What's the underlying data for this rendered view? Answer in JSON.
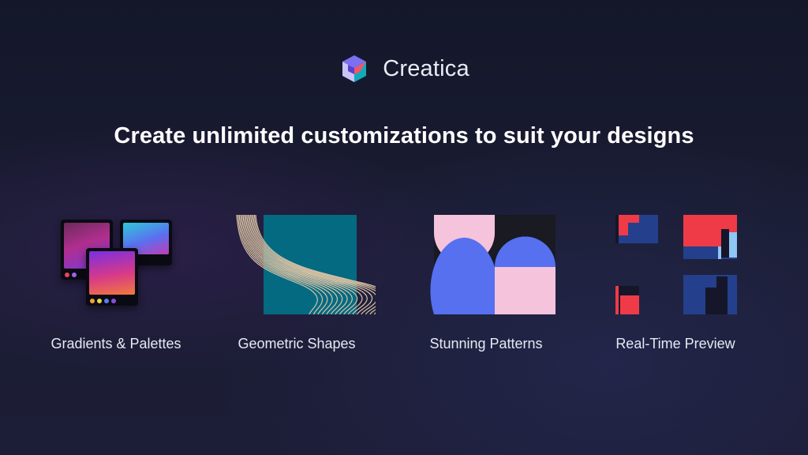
{
  "brand": {
    "name": "Creatica"
  },
  "headline": "Create unlimited customizations to suit your designs",
  "features": [
    {
      "label": "Gradients & Palettes",
      "icon": "gradient-cards-icon"
    },
    {
      "label": "Geometric Shapes",
      "icon": "geometric-curves-icon"
    },
    {
      "label": "Stunning Patterns",
      "icon": "half-circle-pattern-icon"
    },
    {
      "label": "Real-Time Preview",
      "icon": "pixel-preview-icon"
    }
  ],
  "colors": {
    "background": "#171a2e",
    "teal": "#046a82",
    "pink": "#f6c3dc",
    "blue": "#5670f0",
    "red": "#ef3b48",
    "navy": "#24408c",
    "light_blue": "#8ec6f4"
  }
}
